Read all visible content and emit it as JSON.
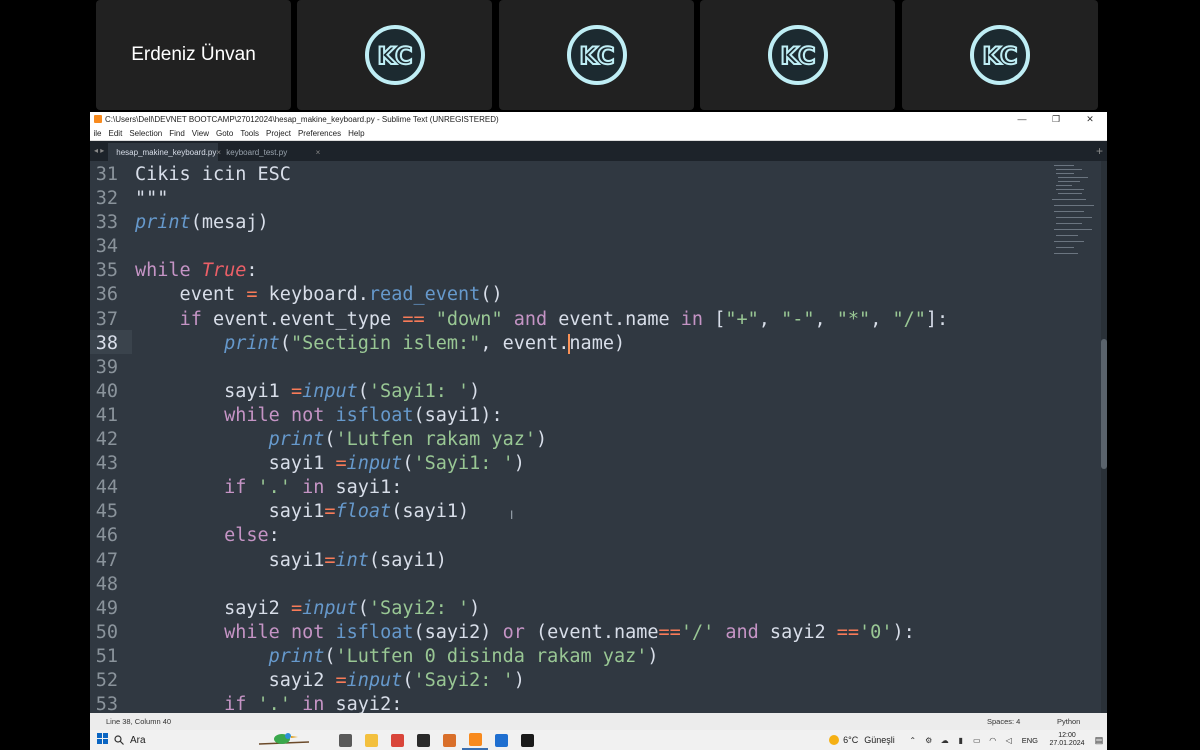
{
  "participants": [
    {
      "name": "Erdeniz Ünvan",
      "logo": null
    },
    {
      "name": "",
      "logo": "KC"
    },
    {
      "name": "",
      "logo": "KC"
    },
    {
      "name": "",
      "logo": "KC"
    },
    {
      "name": "",
      "logo": "KC"
    }
  ],
  "window": {
    "title": "C:\\Users\\Dell\\DEVNET BOOTCAMP\\27012024\\hesap_makine_keyboard.py - Sublime Text (UNREGISTERED)",
    "controls": {
      "minimize": "—",
      "restore": "❐",
      "close": "✕"
    }
  },
  "menu": [
    "ile",
    "Edit",
    "Selection",
    "Find",
    "View",
    "Goto",
    "Tools",
    "Project",
    "Preferences",
    "Help"
  ],
  "tabs": [
    {
      "label": "hesap_makine_keyboard.py",
      "active": true
    },
    {
      "label": "keyboard_test.py",
      "active": false
    }
  ],
  "tab_nav": "◂ ▸",
  "tab_add": "+",
  "tab_close": "×",
  "editor": {
    "current_line": 38,
    "lines": [
      {
        "n": "31",
        "t": [
          [
            "Cikis icin ESC",
            ""
          ]
        ]
      },
      {
        "n": "32",
        "t": [
          [
            "\"\"\"",
            ""
          ]
        ]
      },
      {
        "n": "33",
        "t": [
          [
            "print",
            "f"
          ],
          [
            "(mesaj)",
            ""
          ]
        ]
      },
      {
        "n": "34",
        "t": []
      },
      {
        "n": "35",
        "t": [
          [
            "while ",
            "k"
          ],
          [
            "True",
            "b"
          ],
          [
            ":",
            ""
          ]
        ]
      },
      {
        "n": "36",
        "t": [
          [
            "    event ",
            ""
          ],
          [
            "=",
            "o"
          ],
          [
            " keyboard.",
            ""
          ],
          [
            "read_event",
            "f2"
          ],
          [
            "()",
            ""
          ]
        ]
      },
      {
        "n": "37",
        "t": [
          [
            "    ",
            ""
          ],
          [
            "if",
            "k"
          ],
          [
            " event.event_type ",
            ""
          ],
          [
            "==",
            "o"
          ],
          [
            " ",
            ""
          ],
          [
            "\"down\"",
            "s"
          ],
          [
            " ",
            ""
          ],
          [
            "and",
            "k"
          ],
          [
            " event.name ",
            ""
          ],
          [
            "in",
            "k"
          ],
          [
            " [",
            ""
          ],
          [
            "\"+\"",
            "s"
          ],
          [
            ", ",
            ""
          ],
          [
            "\"-\"",
            "s"
          ],
          [
            ", ",
            ""
          ],
          [
            "\"*\"",
            "s"
          ],
          [
            ", ",
            ""
          ],
          [
            "\"/\"",
            "s"
          ],
          [
            "]:",
            ""
          ]
        ]
      },
      {
        "n": "38",
        "t": [
          [
            "        ",
            ""
          ],
          [
            "print",
            "f"
          ],
          [
            "(",
            ""
          ],
          [
            "\"Sectigin islem:\"",
            "s"
          ],
          [
            ", event.",
            ""
          ],
          [
            "|",
            "caret"
          ],
          [
            "name)",
            ""
          ]
        ]
      },
      {
        "n": "39",
        "t": []
      },
      {
        "n": "40",
        "t": [
          [
            "        sayi1 ",
            ""
          ],
          [
            "=",
            "o"
          ],
          [
            "input",
            "f"
          ],
          [
            "(",
            ""
          ],
          [
            "'Sayi1: '",
            "s"
          ],
          [
            ")",
            ""
          ]
        ]
      },
      {
        "n": "41",
        "t": [
          [
            "        ",
            ""
          ],
          [
            "while",
            "k"
          ],
          [
            " ",
            ""
          ],
          [
            "not",
            "k"
          ],
          [
            " ",
            ""
          ],
          [
            "isfloat",
            "f2"
          ],
          [
            "(sayi1):",
            ""
          ]
        ]
      },
      {
        "n": "42",
        "t": [
          [
            "            ",
            ""
          ],
          [
            "print",
            "f"
          ],
          [
            "(",
            ""
          ],
          [
            "'Lutfen rakam yaz'",
            "s"
          ],
          [
            ")",
            ""
          ]
        ]
      },
      {
        "n": "43",
        "t": [
          [
            "            sayi1 ",
            ""
          ],
          [
            "=",
            "o"
          ],
          [
            "input",
            "f"
          ],
          [
            "(",
            ""
          ],
          [
            "'Sayi1: '",
            "s"
          ],
          [
            ")",
            ""
          ]
        ]
      },
      {
        "n": "44",
        "t": [
          [
            "        ",
            ""
          ],
          [
            "if",
            "k"
          ],
          [
            " ",
            ""
          ],
          [
            "'.'",
            "s"
          ],
          [
            " ",
            ""
          ],
          [
            "in",
            "k"
          ],
          [
            " sayi1:",
            ""
          ]
        ]
      },
      {
        "n": "45",
        "t": [
          [
            "            sayi1",
            ""
          ],
          [
            "=",
            "o"
          ],
          [
            "float",
            "f"
          ],
          [
            "(sayi1)",
            ""
          ]
        ]
      },
      {
        "n": "46",
        "t": [
          [
            "        ",
            ""
          ],
          [
            "else",
            "k"
          ],
          [
            ":",
            ""
          ]
        ]
      },
      {
        "n": "47",
        "t": [
          [
            "            sayi1",
            ""
          ],
          [
            "=",
            "o"
          ],
          [
            "int",
            "f"
          ],
          [
            "(sayi1)",
            ""
          ]
        ]
      },
      {
        "n": "48",
        "t": []
      },
      {
        "n": "49",
        "t": [
          [
            "        sayi2 ",
            ""
          ],
          [
            "=",
            "o"
          ],
          [
            "input",
            "f"
          ],
          [
            "(",
            ""
          ],
          [
            "'Sayi2: '",
            "s"
          ],
          [
            ")",
            ""
          ]
        ]
      },
      {
        "n": "50",
        "t": [
          [
            "        ",
            ""
          ],
          [
            "while",
            "k"
          ],
          [
            " ",
            ""
          ],
          [
            "not",
            "k"
          ],
          [
            " ",
            ""
          ],
          [
            "isfloat",
            "f2"
          ],
          [
            "(sayi2) ",
            ""
          ],
          [
            "or",
            "k"
          ],
          [
            " (event.name",
            ""
          ],
          [
            "==",
            "o"
          ],
          [
            "'/'",
            "s"
          ],
          [
            " ",
            ""
          ],
          [
            "and",
            "k"
          ],
          [
            " sayi2 ",
            ""
          ],
          [
            "==",
            "o"
          ],
          [
            "'0'",
            "s"
          ],
          [
            "):",
            ""
          ]
        ]
      },
      {
        "n": "51",
        "t": [
          [
            "            ",
            ""
          ],
          [
            "print",
            "f"
          ],
          [
            "(",
            ""
          ],
          [
            "'Lutfen 0 disinda rakam yaz'",
            "s"
          ],
          [
            ")",
            ""
          ]
        ]
      },
      {
        "n": "52",
        "t": [
          [
            "            sayi2 ",
            ""
          ],
          [
            "=",
            "o"
          ],
          [
            "input",
            "f"
          ],
          [
            "(",
            ""
          ],
          [
            "'Sayi2: '",
            "s"
          ],
          [
            ")",
            ""
          ]
        ]
      },
      {
        "n": "53",
        "t": [
          [
            "        ",
            ""
          ],
          [
            "if",
            "k"
          ],
          [
            " ",
            ""
          ],
          [
            "'.'",
            "s"
          ],
          [
            " ",
            ""
          ],
          [
            "in",
            "k"
          ],
          [
            " sayi2:",
            ""
          ]
        ]
      }
    ]
  },
  "status": {
    "position": "Line 38, Column 40",
    "spaces": "Spaces: 4",
    "syntax": "Python"
  },
  "taskbar": {
    "search_text": "Ara",
    "weather_temp": "6°C",
    "weather_desc": "Güneşli",
    "lang": "ENG",
    "time": "12:00",
    "date": "27.01.2024",
    "apps": [
      {
        "name": "task-view",
        "color": "#5a5a5a",
        "active": false
      },
      {
        "name": "file-explorer",
        "color": "#f3c03e",
        "active": false
      },
      {
        "name": "chrome",
        "color": "#d9453a",
        "active": false
      },
      {
        "name": "app-dark",
        "color": "#2b2b2b",
        "active": false
      },
      {
        "name": "app-orange",
        "color": "#d96f2a",
        "active": false
      },
      {
        "name": "sublime-text",
        "color": "#f88a1d",
        "active": true
      },
      {
        "name": "app-blue",
        "color": "#1f6fd0",
        "active": false
      },
      {
        "name": "terminal",
        "color": "#1a1a1a",
        "active": false
      }
    ]
  },
  "colors": {
    "editor_bg": "#303841",
    "keyword": "#c594c5",
    "function": "#6699cc",
    "string": "#99c794",
    "boolean": "#ec5f67",
    "operator": "#f97b58"
  }
}
